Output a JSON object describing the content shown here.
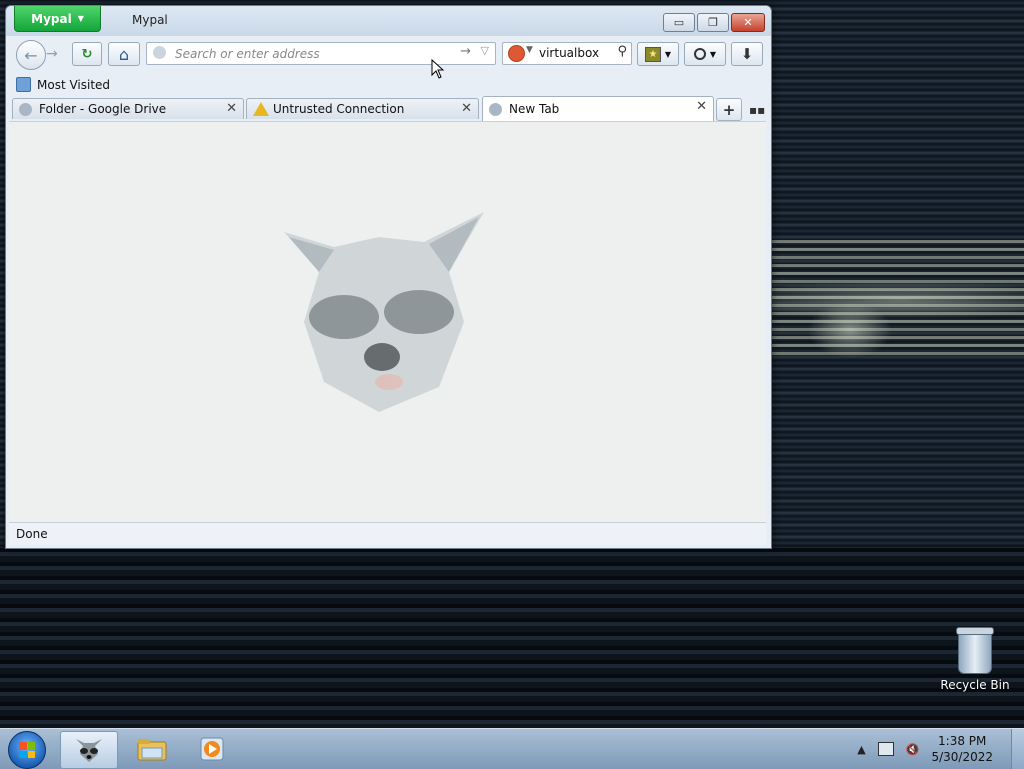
{
  "window": {
    "app_button": "Mypal",
    "title": "Mypal",
    "controls": {
      "minimize": "▭",
      "restore": "❐",
      "close": "✕"
    }
  },
  "navbar": {
    "back_icon": "←",
    "forward_icon": "→",
    "reload_icon": "↻",
    "home_icon": "⌂",
    "address_placeholder": "Search or enter address",
    "go_icon": "→",
    "history_dropdown_icon": "▽",
    "search_value": "virtualbox",
    "search_icon": "⚲",
    "download_icon": "⬇"
  },
  "bookmarks": {
    "items": [
      {
        "label": "Most Visited"
      }
    ]
  },
  "tabs": [
    {
      "label": "Folder - Google Drive",
      "icon": "globe-icon",
      "active": false
    },
    {
      "label": "Untrusted Connection",
      "icon": "warning-icon",
      "active": false
    },
    {
      "label": "New Tab",
      "icon": "globe-icon",
      "active": true
    }
  ],
  "tab_close_icon": "✕",
  "new_tab_icon": "+",
  "status": {
    "text": "Done"
  },
  "desktop": {
    "recycle_bin_label": "Recycle Bin"
  },
  "taskbar": {
    "clock_time": "1:38 PM",
    "clock_date": "5/30/2022"
  },
  "colors": {
    "app_button": "#14a53a",
    "close_button": "#c6412b",
    "ddg_orange": "#de5833"
  }
}
